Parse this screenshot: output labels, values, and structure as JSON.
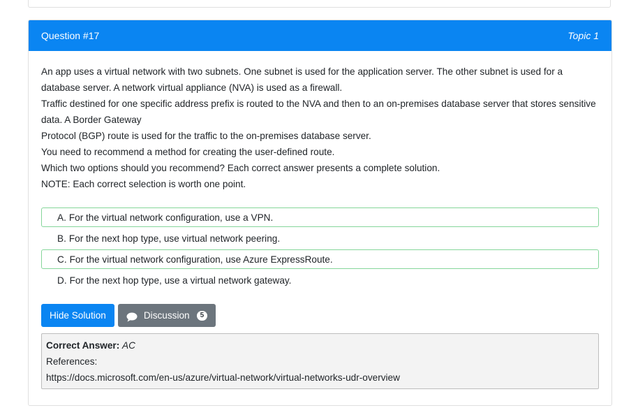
{
  "question": {
    "number_label": "Question #17",
    "topic_label": "Topic 1",
    "text": [
      "An app uses a virtual network with two subnets. One subnet is used for the application server. The other subnet is used for a database server. A network virtual appliance (NVA) is used as a firewall.",
      "Traffic destined for one specific address prefix is routed to the NVA and then to an on-premises database server that stores sensitive data. A Border Gateway",
      "Protocol (BGP) route is used for the traffic to the on-premises database server.",
      "You need to recommend a method for creating the user-defined route.",
      "Which two options should you recommend? Each correct answer presents a complete solution.",
      "NOTE: Each correct selection is worth one point."
    ],
    "choices": [
      {
        "letter": "A.",
        "text": "For the virtual network configuration, use a VPN.",
        "correct": true
      },
      {
        "letter": "B.",
        "text": "For the next hop type, use virtual network peering.",
        "correct": false
      },
      {
        "letter": "C.",
        "text": "For the virtual network configuration, use Azure ExpressRoute.",
        "correct": true
      },
      {
        "letter": "D.",
        "text": "For the next hop type, use a virtual network gateway.",
        "correct": false
      }
    ]
  },
  "buttons": {
    "hide_solution": "Hide Solution",
    "discussion": "Discussion",
    "discussion_count": "5"
  },
  "answer": {
    "label": "Correct Answer:",
    "value": "AC",
    "references_label": "References:",
    "reference_url": "https://docs.microsoft.com/en-us/azure/virtual-network/virtual-networks-udr-overview"
  },
  "colors": {
    "header_bg": "#0a85f2",
    "correct_border": "#85d69a",
    "secondary_button": "#6c757d"
  }
}
